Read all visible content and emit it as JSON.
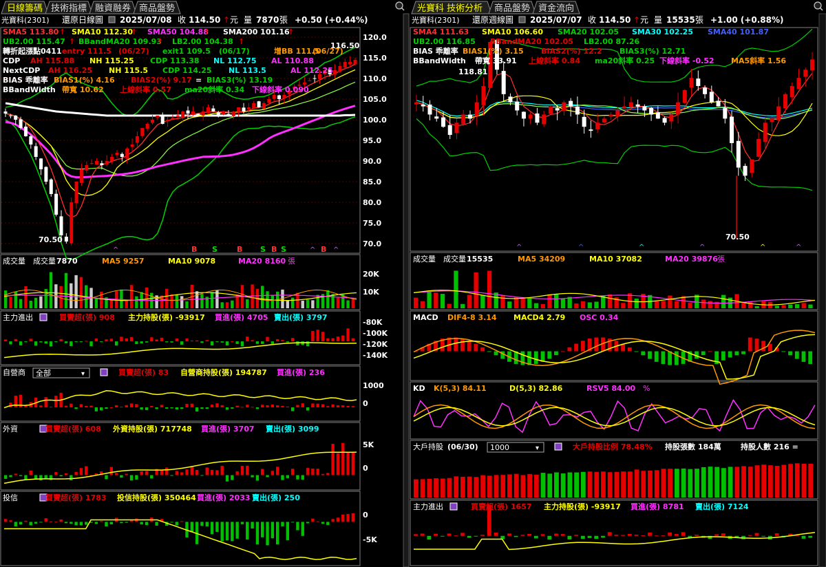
{
  "palette": {
    "up": "#e60000",
    "down": "#00c000",
    "sma5": "#ff3030",
    "sma10": "#ffff00",
    "sma20": "#ff30ff",
    "sma50": "#ff30ff",
    "sma200": "#ffffff",
    "band": "#00d000",
    "cyan": "#00ffff",
    "blue": "#4060ff",
    "orange": "#ff9900",
    "grid": "#5a0000",
    "frame": "#808080"
  },
  "left": {
    "tabs": [
      "日線籌碼",
      "技術指標",
      "融資融券",
      "商品盤勢"
    ],
    "info": {
      "stock": "光寶科(2301)",
      "mode": "還原日線圖",
      "date": "2025/07/08",
      "close_label": "收",
      "close": "114.50",
      "unit": "元",
      "vol_label": "量",
      "vol": "7870",
      "vol_unit": "張",
      "change": "+0.50 (+0.44%)"
    },
    "legend": {
      "row1": [
        "SMA5 113.80",
        "SMA10 112.30",
        "SMA50 104.88",
        "SMA200 101.16"
      ],
      "row2": [
        "UB2.00 115.47",
        "BBandMA20 109.93",
        "LB2.00 104.38"
      ],
      "row3": [
        "轉折起漲點0411",
        "entry 111.5",
        "(06/27)",
        "exit1 109.5",
        "(06/17)",
        "增BB 111.5",
        "(06/27)"
      ],
      "row4": [
        "CDP",
        "AH 115.88",
        "NH 115.25",
        "CDP 113.38",
        "NL 112.75",
        "AL 110.88"
      ],
      "row5": [
        "NextCDP",
        "AH 116.25",
        "NH 115.5",
        "CDP 114.25",
        "NL 113.5",
        "AL 112.25"
      ],
      "row6": [
        "BIAS 乖離率",
        "BIAS1(%) 4.16",
        "BIAS2(%) 9.17",
        "=",
        "BIAS3(%) 13.19"
      ],
      "row7": [
        "BBandWidth",
        "帶寬 10.62",
        "上線斜率 0.57",
        "ma20斜率 0.34",
        "下線斜率 0.090"
      ]
    },
    "price_labels": [
      "120.0",
      "115.0",
      "110.0",
      "105.0",
      "100.0",
      "95.0",
      "90.0",
      "85.0",
      "80.0",
      "75.0",
      "70.0"
    ],
    "hi_label": "116.50",
    "lo_label": "70.50",
    "signals": [
      "B",
      "S",
      "B",
      "S",
      "B",
      "S",
      "B"
    ],
    "vol_panel": {
      "title": "成交量",
      "label": "成交量",
      "value": "7870",
      "ma5": "MA5 9257",
      "ma10": "MA10 9078",
      "ma20": "MA20 8160",
      "unit": "張",
      "axis": [
        "20K",
        "10K"
      ]
    },
    "main_force": {
      "title": "主力進出",
      "buy_over": "買賣超(張) 908",
      "hold": "主力持股(張) -93917",
      "buy": "買進(張) 4705",
      "sell": "賣出(張) 3797",
      "axis": [
        "-80K",
        "-100K",
        "-120K",
        "-140K"
      ]
    },
    "dealer": {
      "title": "自營商",
      "select": "全部",
      "buy_over": "買賣超(張) 83",
      "hold": "自營商持股(張) 194787",
      "buy": "買進(張) 236",
      "axis": [
        "1000",
        "0"
      ]
    },
    "foreign": {
      "title": "外資",
      "buy_over": "買賣超(張) 608",
      "hold": "外資持股(張) 717748",
      "buy": "買進(張) 3707",
      "sell": "賣出(張) 3099",
      "axis": [
        "5K",
        "0"
      ]
    },
    "trust": {
      "title": "投信",
      "buy_over": "買賣超(張) 1783",
      "hold": "投信持股(張) 350464",
      "buy": "買進(張) 2033",
      "sell": "賣出(張) 250",
      "axis": [
        "0",
        "-5K"
      ]
    }
  },
  "right": {
    "tabs": [
      "光寶科 技術分析",
      "商品盤勢",
      "資金流向"
    ],
    "info": {
      "stock": "光寶科(2301)",
      "mode": "還原週線圖",
      "date": "2025/07/07",
      "close_label": "收",
      "close": "114.50",
      "unit": "元",
      "vol_label": "量",
      "vol": "15535",
      "vol_unit": "張",
      "change": "+1.00 (+0.88%)"
    },
    "legend": {
      "row1": [
        "SMA4 111.63",
        "SMA10 106.60",
        "SMA20 102.05",
        "SMA30 102.25",
        "SMA40 101.87"
      ],
      "row2": [
        "UB2.00 116.85",
        "BBandMA20 102.05",
        "LB2.00 87.26"
      ],
      "row3": [
        "BIAS 乖離率",
        "BIAS1(%) 3.15",
        "BIAS2(%) 12.2",
        "BIAS3(%) 12.71"
      ],
      "row4": [
        "BBandWidth",
        "帶寬 33.91",
        "上線斜率 0.84",
        "ma20斜率 0.25",
        "下線斜率 -0.52",
        "MA5斜率 1.56"
      ]
    },
    "hi_label": "118.81",
    "lo_label": "70.50",
    "vol_panel": {
      "title": "成交量",
      "label": "成交量",
      "value": "15535",
      "ma5": "MA5 34209",
      "ma10": "MA10 37082",
      "ma20": "MA20 39876",
      "unit": "張"
    },
    "macd": {
      "title": "MACD",
      "dif": "DIF4-8 3.14",
      "macd": "MACD4 2.79",
      "osc": "OSC 0.34"
    },
    "kd": {
      "title": "KD",
      "k": "K(5,3) 84.11",
      "d": "D(5,3) 82.86",
      "rsv": "RSV5 84.00",
      "pct": "%"
    },
    "holders": {
      "title": "大戶持股",
      "date": "(06/30)",
      "select": "1000",
      "ratio": "大戶持股比例 78.48%",
      "count": "持股張數 184萬",
      "people": "持股人數 216 ="
    },
    "main_force": {
      "title": "主力進出",
      "buy_over": "買賣超(張) 1657",
      "hold": "主力持股(張) -93917",
      "buy": "買進(張) 8781",
      "sell": "賣出(張) 7124"
    }
  },
  "chart_data": [
    {
      "type": "line",
      "title": "光寶科(2301) 還原日線圖",
      "ylim": [
        68,
        122
      ],
      "x_count": 70,
      "close": [
        101.5,
        101,
        100,
        98,
        96,
        94,
        91,
        88,
        85,
        82,
        77,
        72,
        70.5,
        80,
        85,
        88,
        89,
        89.5,
        90,
        89,
        90,
        91,
        92,
        91,
        93,
        94,
        96,
        98,
        99,
        100,
        101,
        99,
        100,
        100.5,
        101,
        102,
        101.5,
        102,
        101,
        102,
        103,
        102,
        101,
        102,
        101,
        102,
        103,
        102,
        103,
        104,
        103,
        104,
        105,
        106,
        105,
        106,
        107,
        108,
        108.5,
        109,
        109.5,
        110,
        111,
        112,
        111,
        112,
        113,
        114,
        114,
        114.5
      ],
      "sma200": [
        104,
        103.8,
        103.6,
        103.4,
        103.2,
        103,
        102.8,
        102.6,
        102.4,
        102.2,
        102,
        101.9,
        101.8,
        101.7,
        101.6,
        101.5,
        101.4,
        101.3,
        101.2,
        101.1,
        101,
        101,
        101,
        101,
        101,
        101,
        101,
        101,
        101,
        101,
        101,
        101,
        101,
        101,
        101,
        101,
        101,
        101,
        101,
        101,
        101,
        101,
        101,
        101,
        101,
        101,
        101,
        101,
        101,
        101,
        101,
        101,
        101,
        101,
        101,
        101,
        101,
        101,
        101,
        101,
        101,
        101,
        101,
        101,
        101,
        101,
        101,
        101.1,
        101.1,
        101.16
      ]
    },
    {
      "type": "line",
      "title": "光寶科(2301) 還原週線圖",
      "ylim": [
        68,
        122
      ],
      "x_count": 60,
      "close": [
        104,
        103,
        101,
        100,
        98,
        96,
        99,
        101,
        100,
        104,
        108,
        118.8,
        112,
        106,
        104,
        102,
        100,
        101,
        99,
        101,
        103,
        102,
        104,
        103,
        101,
        98,
        97,
        99,
        100,
        101,
        102,
        103,
        104,
        103,
        102,
        101,
        100,
        99,
        101,
        104,
        107,
        110,
        108,
        106,
        104,
        103,
        100,
        94,
        88,
        86,
        90,
        95,
        99,
        100,
        103,
        106,
        108,
        110,
        112,
        114.5
      ]
    }
  ]
}
